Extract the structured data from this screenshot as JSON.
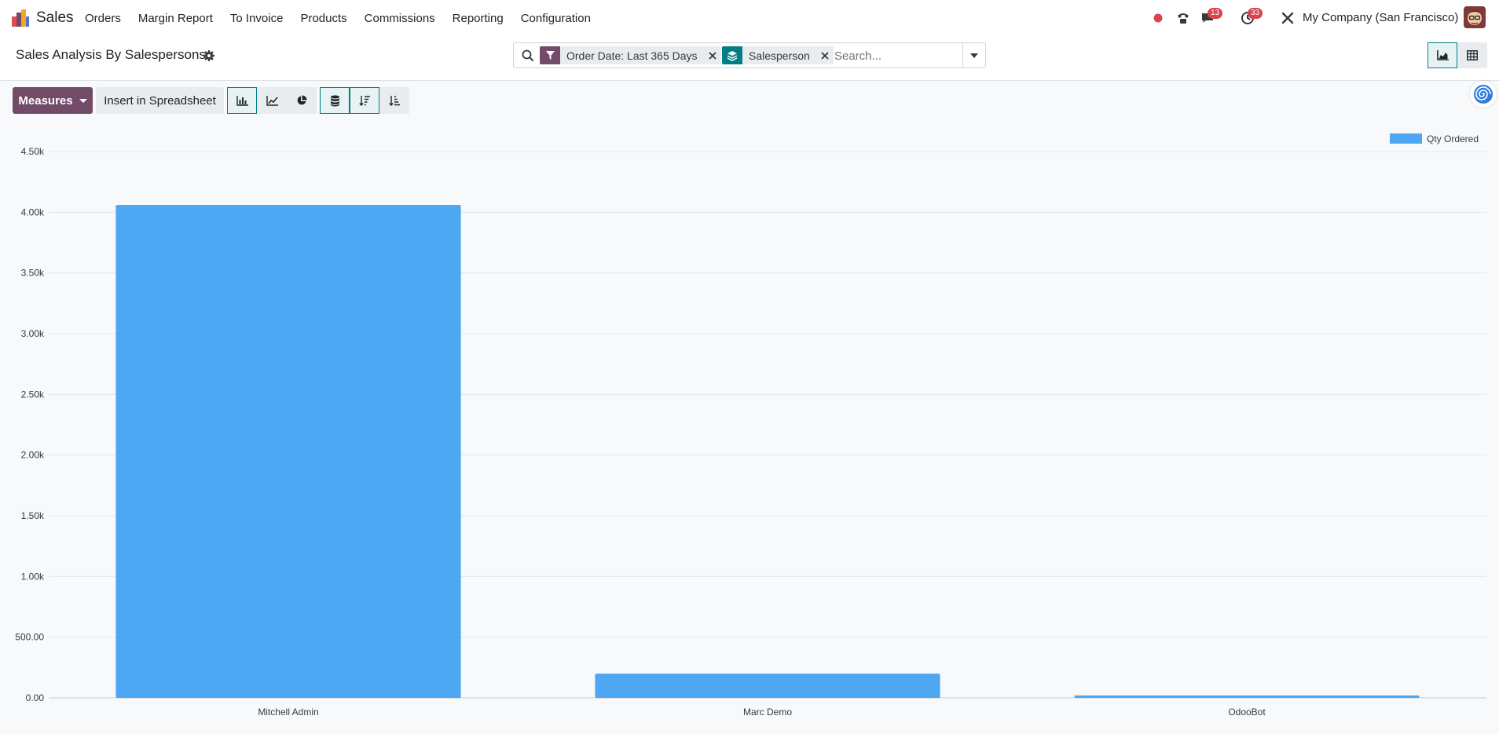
{
  "navbar": {
    "app_name": "Sales",
    "menu": [
      "Orders",
      "Margin Report",
      "To Invoice",
      "Products",
      "Commissions",
      "Reporting",
      "Configuration"
    ],
    "messages_count": "13",
    "activities_count": "33",
    "company": "My Company (San Francisco)"
  },
  "control_panel": {
    "title": "Sales Analysis By Salespersons",
    "facets": [
      {
        "icon": "filter-icon",
        "label": "Order Date: Last 365 Days",
        "color": "#714b67"
      },
      {
        "icon": "group-by-icon",
        "label": "Salesperson",
        "color": "#017e84"
      }
    ],
    "search_placeholder": "Search..."
  },
  "toolbar": {
    "measures_label": "Measures",
    "spreadsheet_label": "Insert in Spreadsheet"
  },
  "colors": {
    "primary": "#714b67",
    "accent": "#017e84",
    "bar": "#4ea7f2",
    "badge": "#d9434c"
  },
  "chart_data": {
    "type": "bar",
    "categories": [
      "Mitchell Admin",
      "Marc Demo",
      "OdooBot"
    ],
    "series": [
      {
        "name": "Qty Ordered",
        "values": [
          4060,
          200,
          20
        ]
      }
    ],
    "ylim": [
      0,
      4500
    ],
    "yticks": [
      "0.00",
      "500.00",
      "1.00k",
      "1.50k",
      "2.00k",
      "2.50k",
      "3.00k",
      "3.50k",
      "4.00k",
      "4.50k"
    ],
    "legend": "top-right",
    "grid": true
  }
}
